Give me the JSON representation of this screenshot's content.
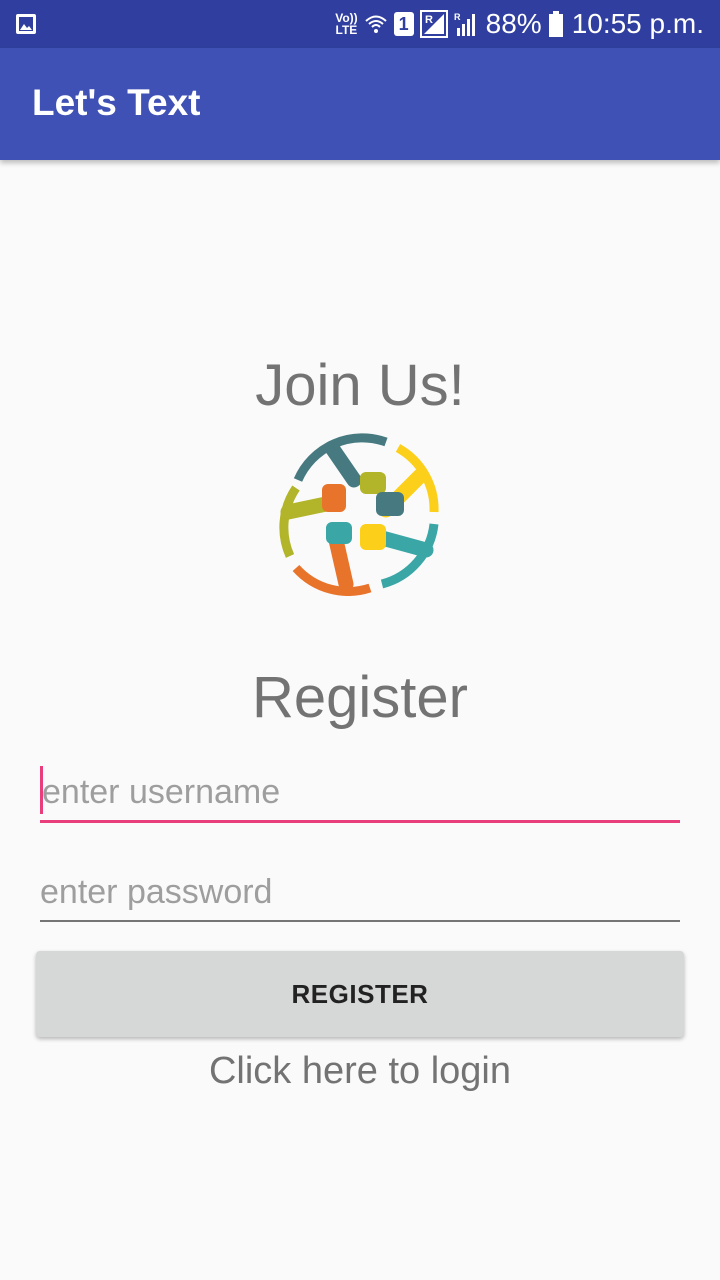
{
  "status_bar": {
    "volte_top": "Vo))",
    "volte_bottom": "LTE",
    "sim_slot": "1",
    "battery_percent": "88%",
    "time": "10:55 p.m.",
    "icons": [
      "gallery-icon",
      "volte-icon",
      "wifi-icon",
      "sim-icon",
      "roaming-signal-icon",
      "signal-icon",
      "battery-icon"
    ]
  },
  "app_bar": {
    "title": "Let's Text"
  },
  "main": {
    "join_title": "Join Us!",
    "logo_icon": "hands-circle-icon",
    "register_title": "Register",
    "username_placeholder": "enter username",
    "password_placeholder": "enter password",
    "register_button": "REGISTER",
    "login_link": "Click here to login"
  },
  "colors": {
    "status_bar": "#303f9f",
    "app_bar": "#3f51b5",
    "accent": "#e83e7c",
    "button": "#d6d7d7",
    "background": "#fafafa",
    "logo_teal_dark": "#467a80",
    "logo_yellow": "#fccf1a",
    "logo_teal": "#3aa6a6",
    "logo_orange": "#e8742c",
    "logo_olive": "#b2b429"
  }
}
